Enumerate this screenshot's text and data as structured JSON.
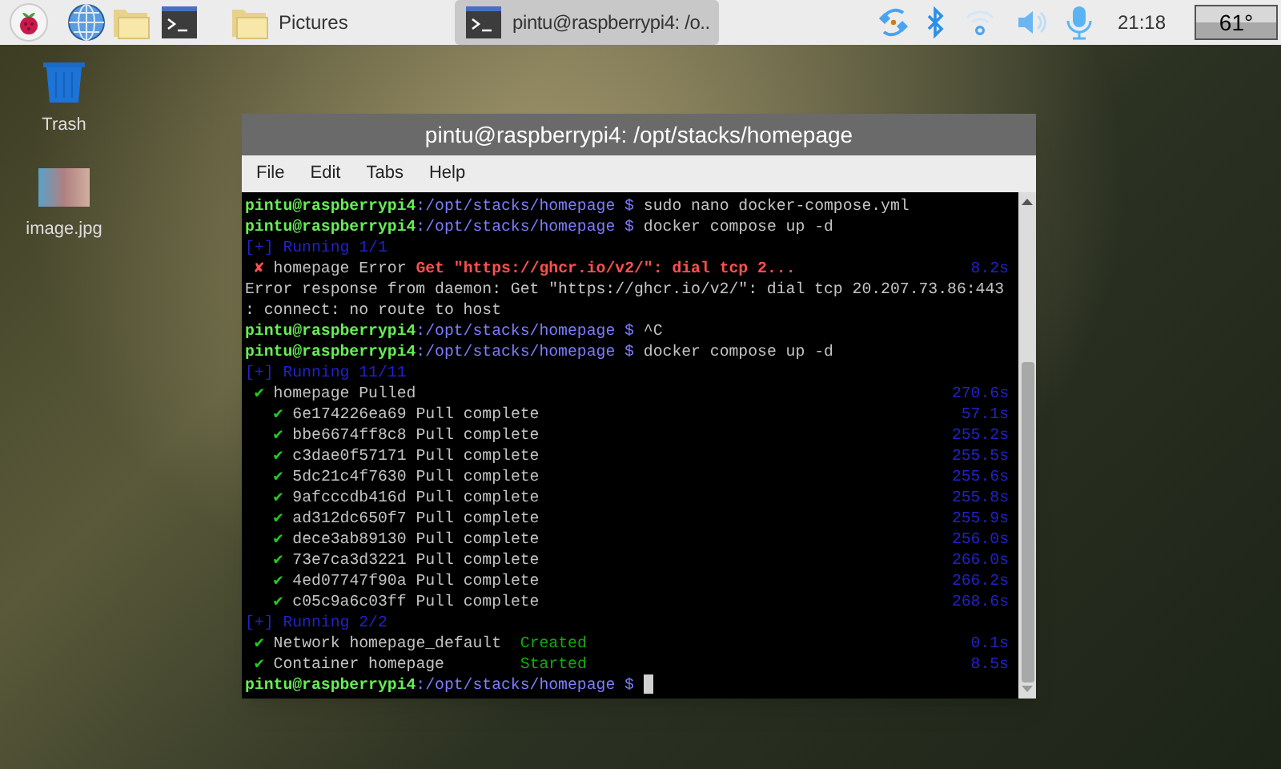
{
  "taskbar": {
    "window_buttons": [
      {
        "label": "Pictures",
        "kind": "folder",
        "selected": false
      },
      {
        "label": "pintu@raspberrypi4: /o..",
        "kind": "terminal",
        "selected": true
      }
    ],
    "clock": "21:18",
    "temperature": "61°"
  },
  "desktop_icons": [
    {
      "label": "Trash",
      "kind": "trash"
    },
    {
      "label": "image.jpg",
      "kind": "photo"
    }
  ],
  "window": {
    "title": "pintu@raspberrypi4: /opt/stacks/homepage",
    "menu": [
      "File",
      "Edit",
      "Tabs",
      "Help"
    ],
    "terminal_lines": [
      {
        "segments": [
          {
            "text": "pintu@raspberrypi4",
            "kind": "user"
          },
          {
            "text": ":/opt/stacks/homepage $",
            "kind": "path"
          },
          {
            "text": " sudo nano docker-compose.yml",
            "kind": "plain"
          }
        ]
      },
      {
        "segments": [
          {
            "text": "pintu@raspberrypi4",
            "kind": "user"
          },
          {
            "text": ":/opt/stacks/homepage $",
            "kind": "path"
          },
          {
            "text": " docker compose up -d",
            "kind": "plain"
          }
        ]
      },
      {
        "segments": [
          {
            "text": "[+] Running 1/1",
            "kind": "running"
          }
        ]
      },
      {
        "segments": [
          {
            "text": " ✘",
            "kind": "error"
          },
          {
            "text": " homepage Error ",
            "kind": "plain"
          },
          {
            "text": "Get \"https://ghcr.io/v2/\": dial tcp 2...",
            "kind": "error"
          }
        ],
        "time": "8.2s"
      },
      {
        "segments": [
          {
            "text": "Error response from daemon: Get \"https://ghcr.io/v2/\": dial tcp 20.207.73.86:443",
            "kind": "plain"
          }
        ]
      },
      {
        "segments": [
          {
            "text": ": connect: no route to host",
            "kind": "plain"
          }
        ]
      },
      {
        "segments": [
          {
            "text": "pintu@raspberrypi4",
            "kind": "user"
          },
          {
            "text": ":/opt/stacks/homepage $",
            "kind": "path"
          },
          {
            "text": " ^C",
            "kind": "plain"
          }
        ]
      },
      {
        "segments": [
          {
            "text": "pintu@raspberrypi4",
            "kind": "user"
          },
          {
            "text": ":/opt/stacks/homepage $",
            "kind": "path"
          },
          {
            "text": " docker compose up -d",
            "kind": "plain"
          }
        ]
      },
      {
        "segments": [
          {
            "text": "[+] Running 11/11",
            "kind": "running"
          }
        ]
      },
      {
        "segments": [
          {
            "text": " ✔",
            "kind": "ok"
          },
          {
            "text": " homepage Pulled",
            "kind": "plain"
          }
        ],
        "time": "270.6s"
      },
      {
        "segments": [
          {
            "text": "   ✔",
            "kind": "ok"
          },
          {
            "text": " 6e174226ea69 Pull complete",
            "kind": "plain"
          }
        ],
        "time": "57.1s"
      },
      {
        "segments": [
          {
            "text": "   ✔",
            "kind": "ok"
          },
          {
            "text": " bbe6674ff8c8 Pull complete",
            "kind": "plain"
          }
        ],
        "time": "255.2s"
      },
      {
        "segments": [
          {
            "text": "   ✔",
            "kind": "ok"
          },
          {
            "text": " c3dae0f57171 Pull complete",
            "kind": "plain"
          }
        ],
        "time": "255.5s"
      },
      {
        "segments": [
          {
            "text": "   ✔",
            "kind": "ok"
          },
          {
            "text": " 5dc21c4f7630 Pull complete",
            "kind": "plain"
          }
        ],
        "time": "255.6s"
      },
      {
        "segments": [
          {
            "text": "   ✔",
            "kind": "ok"
          },
          {
            "text": " 9afcccdb416d Pull complete",
            "kind": "plain"
          }
        ],
        "time": "255.8s"
      },
      {
        "segments": [
          {
            "text": "   ✔",
            "kind": "ok"
          },
          {
            "text": " ad312dc650f7 Pull complete",
            "kind": "plain"
          }
        ],
        "time": "255.9s"
      },
      {
        "segments": [
          {
            "text": "   ✔",
            "kind": "ok"
          },
          {
            "text": " dece3ab89130 Pull complete",
            "kind": "plain"
          }
        ],
        "time": "256.0s"
      },
      {
        "segments": [
          {
            "text": "   ✔",
            "kind": "ok"
          },
          {
            "text": " 73e7ca3d3221 Pull complete",
            "kind": "plain"
          }
        ],
        "time": "266.0s"
      },
      {
        "segments": [
          {
            "text": "   ✔",
            "kind": "ok"
          },
          {
            "text": " 4ed07747f90a Pull complete",
            "kind": "plain"
          }
        ],
        "time": "266.2s"
      },
      {
        "segments": [
          {
            "text": "   ✔",
            "kind": "ok"
          },
          {
            "text": " c05c9a6c03ff Pull complete",
            "kind": "plain"
          }
        ],
        "time": "268.6s"
      },
      {
        "segments": [
          {
            "text": "[+] Running 2/2",
            "kind": "running"
          }
        ]
      },
      {
        "segments": [
          {
            "text": " ✔",
            "kind": "ok"
          },
          {
            "text": " Network homepage_default  ",
            "kind": "plain"
          },
          {
            "text": "Created",
            "kind": "status"
          }
        ],
        "time": "0.1s"
      },
      {
        "segments": [
          {
            "text": " ✔",
            "kind": "ok"
          },
          {
            "text": " Container homepage        ",
            "kind": "plain"
          },
          {
            "text": "Started",
            "kind": "status"
          }
        ],
        "time": "8.5s"
      },
      {
        "segments": [
          {
            "text": "pintu@raspberrypi4",
            "kind": "user"
          },
          {
            "text": ":/opt/stacks/homepage $",
            "kind": "path"
          }
        ],
        "cursor": true
      }
    ]
  }
}
